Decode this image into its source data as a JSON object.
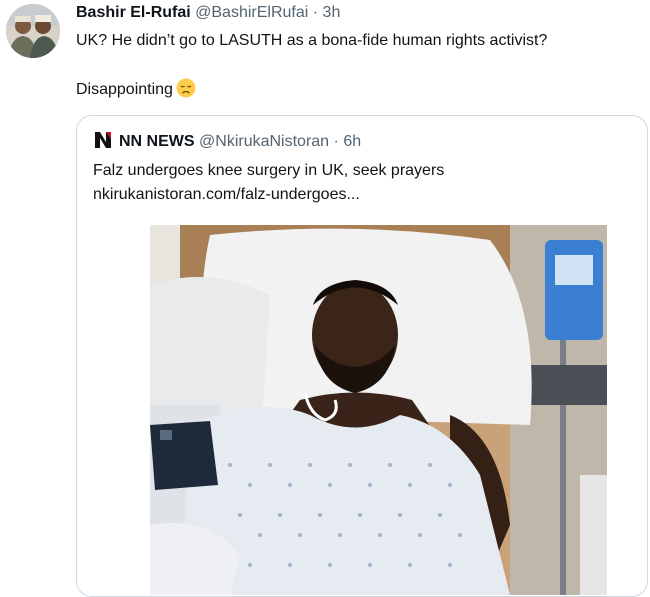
{
  "tweet": {
    "author_name": "Bashir El-Rufai",
    "author_handle": "@BashirElRufai",
    "separator": "·",
    "time": "3h",
    "text_line1": "UK? He didn’t go to LASUTH as a bona-fide human rights activist?",
    "text_line2": "Disappointing",
    "emoji": "disappointed-face-icon"
  },
  "quote": {
    "source_name": "NN NEWS",
    "source_handle": "@NkirukaNistoran",
    "separator": "·",
    "time": "6h",
    "headline": "Falz undergoes knee surgery in UK, seek prayers",
    "link": "nkirukanistoran.com/falz-undergoes...",
    "logo_color": "#c8102e"
  },
  "colors": {
    "primary_text": "#0f1419",
    "secondary_text": "#536471",
    "border": "#cfd9de"
  }
}
